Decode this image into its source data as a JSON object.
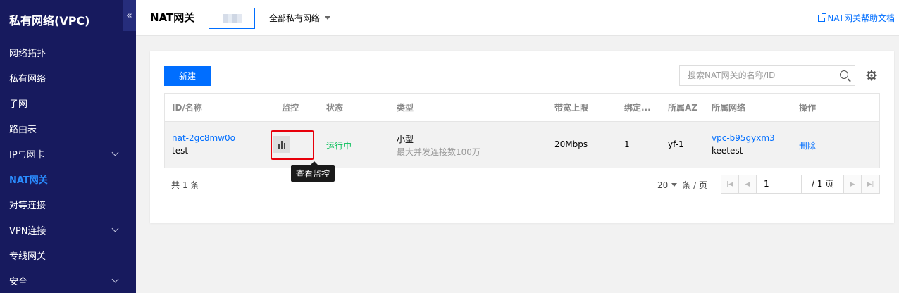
{
  "sidebar": {
    "title": "私有网络(VPC)",
    "collapse_icon": "«",
    "items": [
      {
        "label": "网络拓扑",
        "expandable": false
      },
      {
        "label": "私有网络",
        "expandable": false
      },
      {
        "label": "子网",
        "expandable": false
      },
      {
        "label": "路由表",
        "expandable": false
      },
      {
        "label": "IP与网卡",
        "expandable": true
      },
      {
        "label": "NAT网关",
        "expandable": false,
        "active": true
      },
      {
        "label": "对等连接",
        "expandable": false
      },
      {
        "label": "VPN连接",
        "expandable": true
      },
      {
        "label": "专线网关",
        "expandable": false
      },
      {
        "label": "安全",
        "expandable": true
      }
    ]
  },
  "topbar": {
    "title": "NAT网关",
    "vpc_select": "全部私有网络",
    "help_link": "NAT网关帮助文档"
  },
  "toolbar": {
    "new_button": "新建",
    "search_placeholder": "搜索NAT网关的名称/ID"
  },
  "table": {
    "headers": [
      "ID/名称",
      "监控",
      "状态",
      "类型",
      "带宽上限",
      "绑定...",
      "所属AZ",
      "所属网络",
      "操作"
    ],
    "rows": [
      {
        "id": "nat-2gc8mw0o",
        "name": "test",
        "status": "运行中",
        "type": "小型",
        "type_desc": "最大并发连接数100万",
        "bandwidth": "20Mbps",
        "bound": "1",
        "az": "yf-1",
        "vpc_id": "vpc-b95gyxm3",
        "vpc_name": "keetest",
        "action": "删除"
      }
    ]
  },
  "tooltip": "查看监控",
  "pagination": {
    "total": "共 1 条",
    "page_size": "20",
    "page_size_unit": "条 / 页",
    "current_page": "1",
    "total_pages": "/ 1 页"
  },
  "colors": {
    "sidebar_bg": "#171a5e",
    "accent": "#006eff",
    "running": "#0abf5b",
    "highlight": "#e8000b"
  }
}
